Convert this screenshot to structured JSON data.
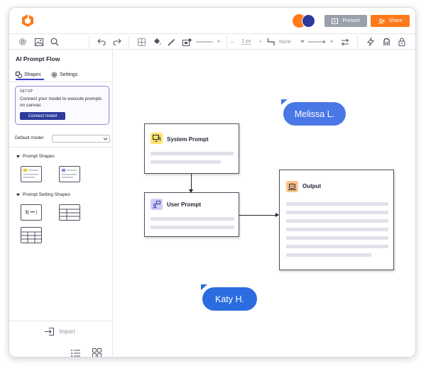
{
  "header": {
    "present_label": "Present",
    "share_label": "Share"
  },
  "toolbar": {
    "stroke_width": "2 px",
    "arrow_start": "None"
  },
  "sidebar": {
    "title": "AI Prompt Flow",
    "tabs": [
      {
        "label": "Shapes"
      },
      {
        "label": "Settings"
      }
    ],
    "setup": {
      "label": "SETUP",
      "text": "Connect your model to execute prompts on canvas",
      "button": "Connect model"
    },
    "default_model_label": "Default model",
    "default_model_value": "",
    "sections": [
      {
        "label": "Prompt Shapes"
      },
      {
        "label": "Prompt Setting Shapes"
      }
    ],
    "variable_shape_text": "${ ••• }",
    "import_label": "Import"
  },
  "canvas": {
    "nodes": [
      {
        "title": "System Prompt"
      },
      {
        "title": "User Prompt"
      },
      {
        "title": "Output"
      }
    ],
    "cursors": [
      {
        "name": "Melissa L."
      },
      {
        "name": "Katy H."
      }
    ]
  },
  "colors": {
    "accent": "#3b45c4",
    "brand_orange": "#ff7a1a",
    "collab_blue": "#2b6de0",
    "navy": "#2d3a9c"
  }
}
